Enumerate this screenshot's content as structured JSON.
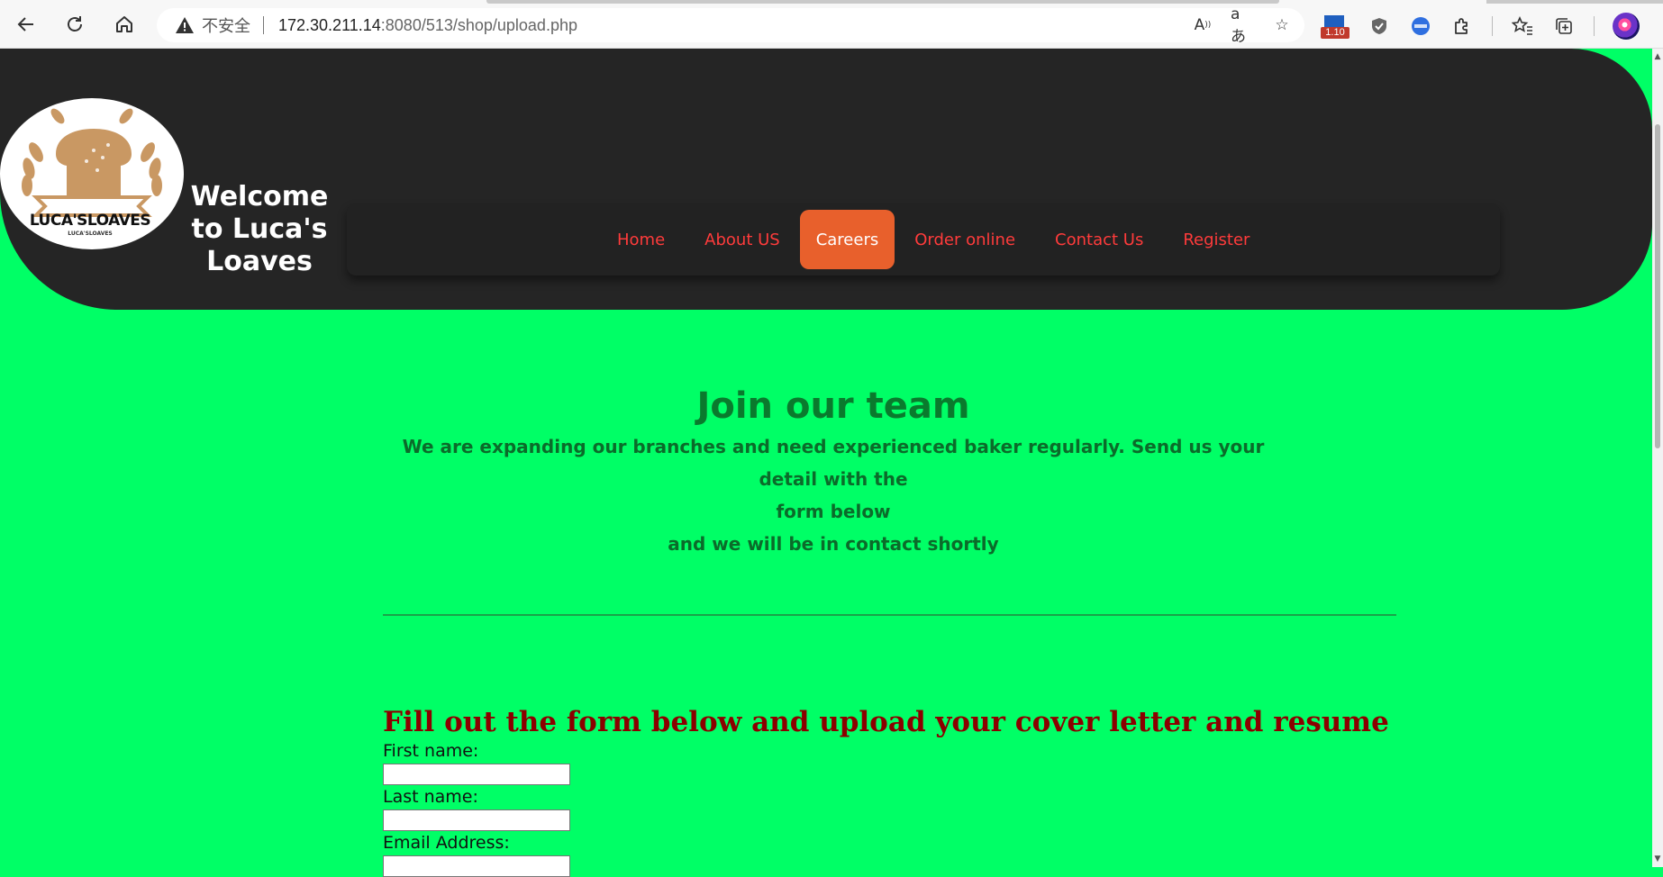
{
  "browser": {
    "insecure_label": "不安全",
    "url_host": "172.30.211.14",
    "url_path": ":8080/513/shop/upload.php",
    "extension_badge": "1.10"
  },
  "site": {
    "logo_text": "LUCA'SLOAVES",
    "logo_subtext": "LUCA'SLOAVES",
    "title": "Welcome to Luca's Loaves",
    "brand_colors": {
      "header_bg": "#252525",
      "page_bg": "#00ff66",
      "accent": "#e8602c",
      "nav_link": "#ff3b3b"
    }
  },
  "nav": {
    "items": [
      {
        "label": "Home",
        "active": false
      },
      {
        "label": "About US",
        "active": false
      },
      {
        "label": "Careers",
        "active": true
      },
      {
        "label": "Order online",
        "active": false
      },
      {
        "label": "Contact Us",
        "active": false
      },
      {
        "label": "Register",
        "active": false
      }
    ]
  },
  "main": {
    "heading": "Join our team",
    "description_line1": "We are expanding our branches and need experienced baker regularly. Send us your detail with the",
    "description_line2": "form below",
    "description_line3": "and we will be in contact shortly"
  },
  "form": {
    "title": "Fill out the form below and upload your cover letter and resume",
    "first_name_label": "First name:",
    "first_name_value": "",
    "last_name_label": "Last name:",
    "last_name_value": "",
    "email_label": "Email Address:",
    "email_value": ""
  },
  "icons": {
    "back": "back-arrow-icon",
    "reload": "reload-icon",
    "home": "home-icon",
    "warning": "warning-icon",
    "read_aloud": "read-aloud-icon",
    "translate": "translate-icon",
    "favorite_add": "add-favorite-icon",
    "extensions": "puzzle-icon",
    "favorites": "favorites-icon",
    "collections": "collections-icon"
  }
}
